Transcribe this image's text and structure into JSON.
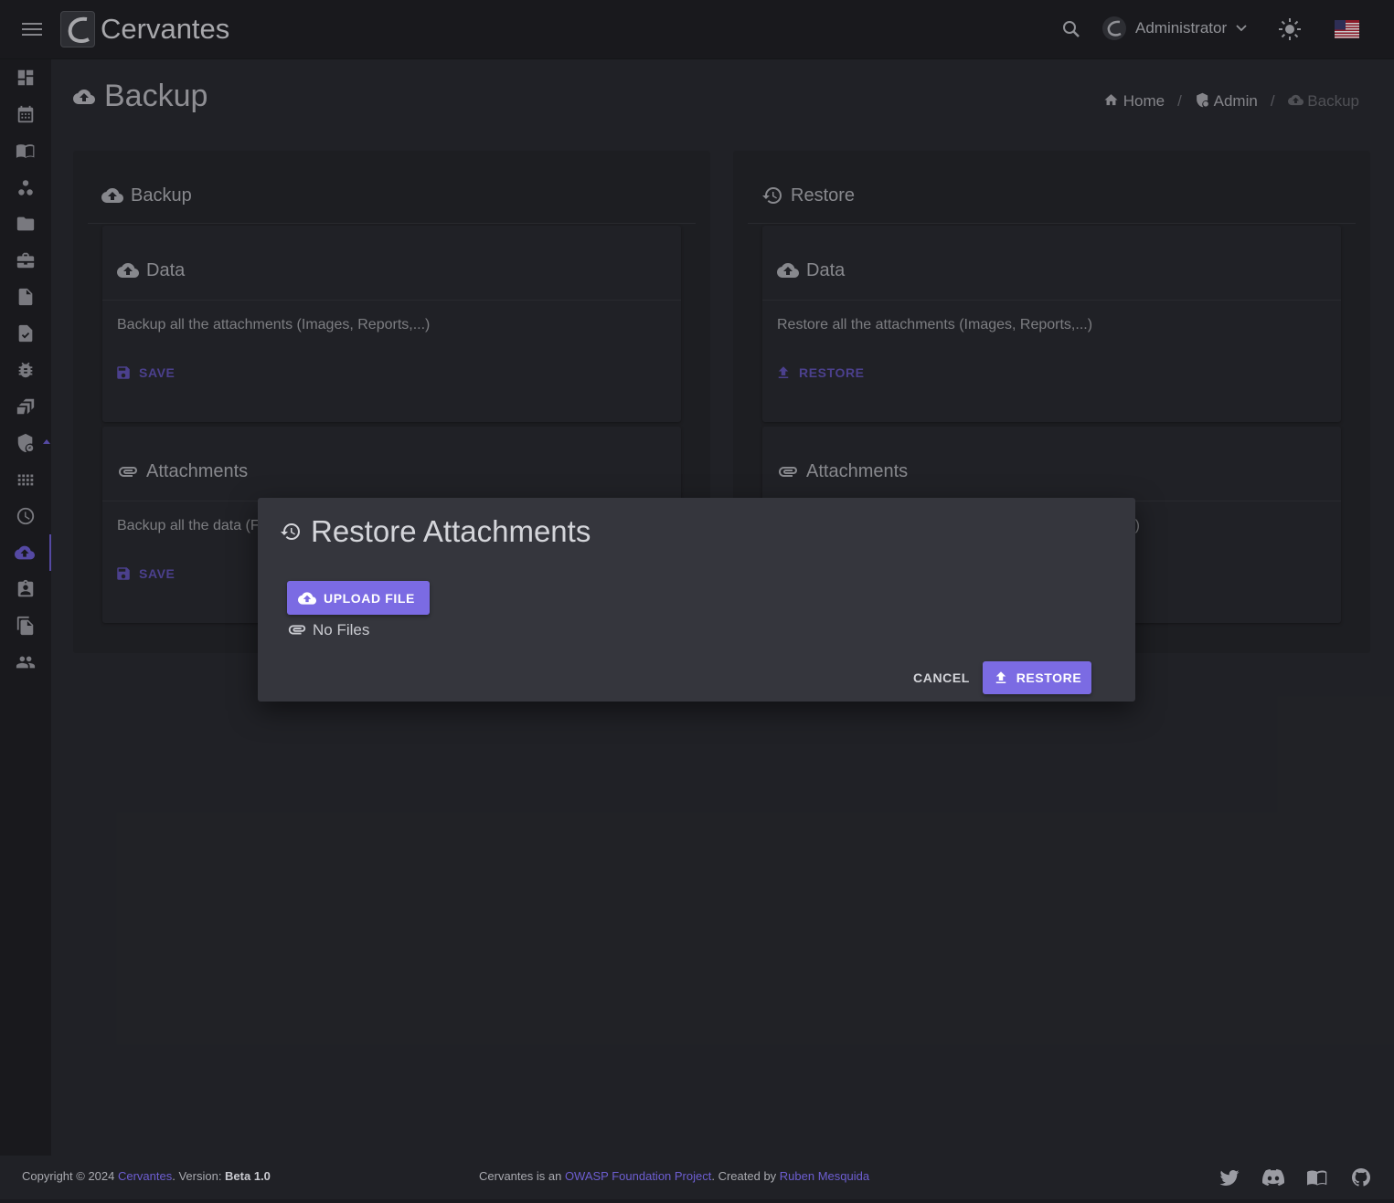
{
  "app": {
    "name": "Cervantes"
  },
  "header": {
    "user": "Administrator"
  },
  "page": {
    "title": "Backup"
  },
  "breadcrumb": {
    "home": "Home",
    "admin": "Admin",
    "current": "Backup"
  },
  "backup": {
    "title": "Backup",
    "data_card": {
      "title": "Data",
      "description": "Backup all the attachments (Images, Reports,...)",
      "action": "SAVE"
    },
    "attachments_card": {
      "title": "Attachments",
      "description": "Backup all the data (F",
      "action": "SAVE"
    }
  },
  "restore": {
    "title": "Restore",
    "data_card": {
      "title": "Data",
      "description": "Restore all the attachments (Images, Reports,...)",
      "action": "RESTORE"
    },
    "attachments_card": {
      "title": "Attachments",
      "description_tail": ")"
    }
  },
  "dialog": {
    "title": "Restore Attachments",
    "upload_label": "UPLOAD FILE",
    "no_files": "No Files",
    "cancel_label": "CANCEL",
    "restore_label": "RESTORE"
  },
  "footer": {
    "copyright": "Copyright © 2024 ",
    "brand": "Cervantes",
    "version_label": ". Version: ",
    "version": "Beta 1.0",
    "project_prefix": "Cervantes is an ",
    "project_link": "OWASP Foundation Project",
    "created_by": ". Created by ",
    "author": "Ruben Mesquida"
  },
  "theme": {
    "accent": "#7b6be3",
    "accent_dark": "#6152b5",
    "background": "#2a2b31",
    "bar": "#202126"
  },
  "icons": [
    "menu-icon",
    "search-icon",
    "sun-icon",
    "flag-icon",
    "cloud-upload-icon",
    "history-icon",
    "paperclip-icon",
    "save-icon",
    "upload-icon",
    "home-icon",
    "shield-icon",
    "twitter-icon",
    "discord-icon",
    "book-icon",
    "github-icon"
  ]
}
